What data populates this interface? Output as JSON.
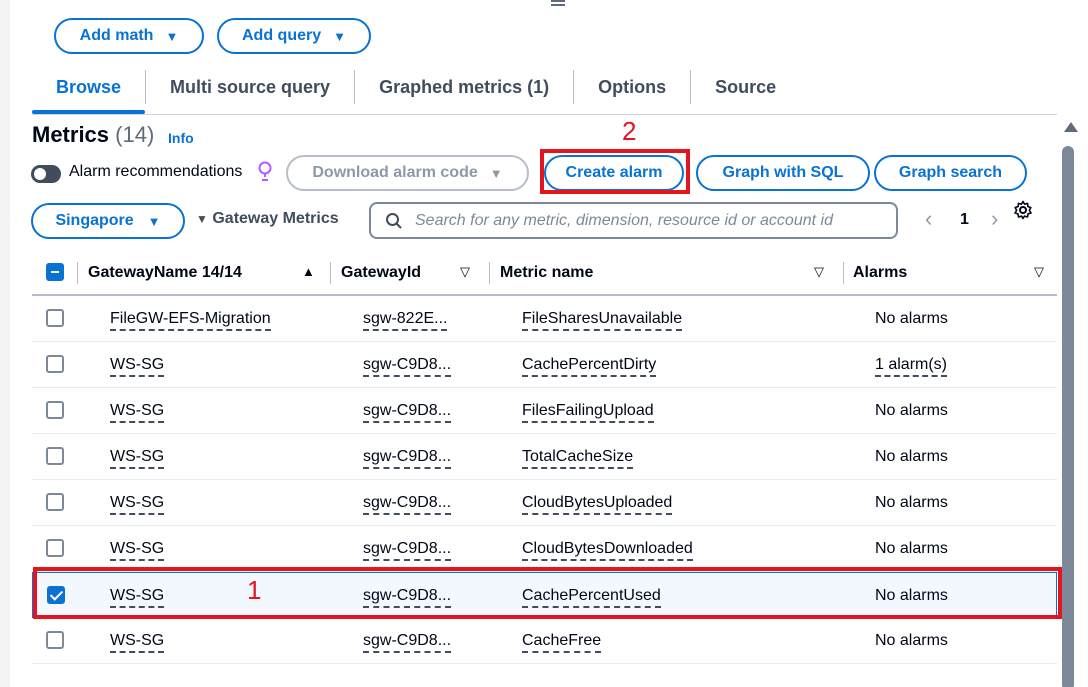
{
  "toolbar": {
    "add_math": "Add math",
    "add_query": "Add query"
  },
  "tabs": [
    {
      "label": "Browse",
      "active": true
    },
    {
      "label": "Multi source query",
      "active": false
    },
    {
      "label": "Graphed metrics (1)",
      "active": false
    },
    {
      "label": "Options",
      "active": false
    },
    {
      "label": "Source",
      "active": false
    }
  ],
  "metrics": {
    "title": "Metrics",
    "count": "(14)",
    "info": "Info",
    "alarm_recommendations": "Alarm recommendations",
    "download_alarm_code": "Download alarm code",
    "create_alarm": "Create alarm",
    "graph_with_sql": "Graph with SQL",
    "graph_search": "Graph search"
  },
  "filters": {
    "region": "Singapore",
    "namespace": "Gateway Metrics",
    "search_placeholder": "Search for any metric, dimension, resource id or account id",
    "page": "1"
  },
  "annotations": {
    "row_marker": "1",
    "button_marker": "2",
    "highlight_color": "#e3151f"
  },
  "table": {
    "columns": [
      "GatewayName 14/14",
      "GatewayId",
      "Metric name",
      "Alarms"
    ],
    "rows": [
      {
        "checked": false,
        "name": "FileGW-EFS-Migration",
        "id": "sgw-822E...",
        "metric": "FileSharesUnavailable",
        "alarms": "No alarms"
      },
      {
        "checked": false,
        "name": "WS-SG",
        "id": "sgw-C9D8...",
        "metric": "CachePercentDirty",
        "alarms": "1 alarm(s)"
      },
      {
        "checked": false,
        "name": "WS-SG",
        "id": "sgw-C9D8...",
        "metric": "FilesFailingUpload",
        "alarms": "No alarms"
      },
      {
        "checked": false,
        "name": "WS-SG",
        "id": "sgw-C9D8...",
        "metric": "TotalCacheSize",
        "alarms": "No alarms"
      },
      {
        "checked": false,
        "name": "WS-SG",
        "id": "sgw-C9D8...",
        "metric": "CloudBytesUploaded",
        "alarms": "No alarms"
      },
      {
        "checked": false,
        "name": "WS-SG",
        "id": "sgw-C9D8...",
        "metric": "CloudBytesDownloaded",
        "alarms": "No alarms"
      },
      {
        "checked": true,
        "name": "WS-SG",
        "id": "sgw-C9D8...",
        "metric": "CachePercentUsed",
        "alarms": "No alarms"
      },
      {
        "checked": false,
        "name": "WS-SG",
        "id": "sgw-C9D8...",
        "metric": "CacheFree",
        "alarms": "No alarms"
      }
    ]
  },
  "colors": {
    "accent": "#0972d3",
    "annotation": "#e3151f"
  }
}
